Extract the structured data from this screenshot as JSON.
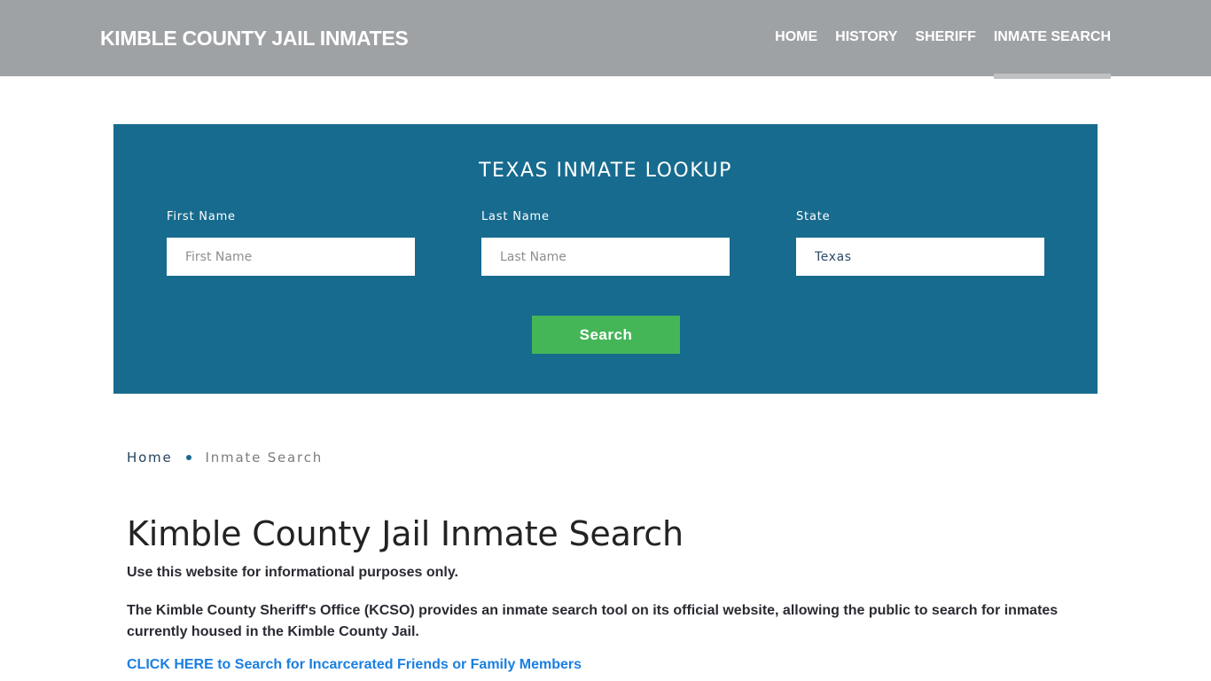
{
  "header": {
    "brand": "KIMBLE COUNTY JAIL INMATES",
    "nav": [
      {
        "label": "HOME",
        "active": false
      },
      {
        "label": "HISTORY",
        "active": false
      },
      {
        "label": "SHERIFF",
        "active": false
      },
      {
        "label": "INMATE SEARCH",
        "active": true
      }
    ]
  },
  "lookup": {
    "title": "TEXAS INMATE LOOKUP",
    "first_name": {
      "label": "First Name",
      "placeholder": "First Name",
      "value": ""
    },
    "last_name": {
      "label": "Last Name",
      "placeholder": "Last Name",
      "value": ""
    },
    "state": {
      "label": "State",
      "value": "Texas"
    },
    "search_label": "Search"
  },
  "breadcrumb": {
    "home": "Home",
    "current": "Inmate Search"
  },
  "content": {
    "title": "Kimble County Jail Inmate Search",
    "disclaimer": "Use this website for informational purposes only.",
    "intro": "The Kimble County Sheriff's Office (KCSO) provides an inmate search tool on its official website, allowing the public to search for inmates currently housed in the Kimble County Jail.",
    "cta": "CLICK HERE to Search for Incarcerated Friends or Family Members"
  },
  "colors": {
    "header_bg": "#9ea2a5",
    "lookup_bg": "#176b8e",
    "search_button": "#44b658",
    "link": "#1a7fe0"
  }
}
